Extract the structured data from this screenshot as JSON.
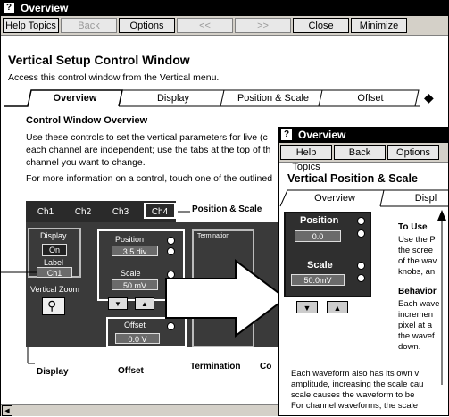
{
  "back_window": {
    "title": "Overview",
    "toolbar": {
      "help_topics": "Help Topics",
      "back": "Back",
      "options": "Options",
      "prev": "<<",
      "next": ">>",
      "close": "Close",
      "minimize": "Minimize"
    },
    "heading": "Vertical Setup Control Window",
    "intro": "Access this control window from the Vertical menu.",
    "tabs": [
      "Overview",
      "Display",
      "Position & Scale",
      "Offset"
    ],
    "section_title": "Control Window Overview",
    "body1": "Use these controls to set the vertical parameters for live (c",
    "body2": "each channel are independent; use the tabs at the top of th",
    "body3": "channel you want to change.",
    "body4": "For more information on a control, touch one of the outlined",
    "channel_tabs": [
      "Ch1",
      "Ch2",
      "Ch3",
      "Ch4"
    ],
    "callouts": {
      "position_scale": "Position & Scale",
      "display": "Display",
      "offset": "Offset",
      "termination": "Termination",
      "coupling": "Co"
    },
    "controls": {
      "display_label": "Display",
      "display_value": "On",
      "label_label": "Label",
      "label_value": "Ch1",
      "vzoom_label": "Vertical Zoom",
      "position_label": "Position",
      "position_value": "3.5 div",
      "scale_label": "Scale",
      "scale_value": "50 mV",
      "offset_label": "Offset",
      "offset_value": "0.0 V",
      "termination_label": "Termination"
    }
  },
  "front_window": {
    "title": "Overview",
    "toolbar": {
      "help_topics": "Help Topics",
      "back": "Back",
      "options": "Options"
    },
    "heading": "Vertical Position & Scale",
    "tabs": [
      "Overview",
      "Displ"
    ],
    "controls": {
      "position_label": "Position",
      "position_value": "0.0",
      "scale_label": "Scale",
      "scale_value": "50.0mV"
    },
    "to_use_title": "To Use",
    "to_use_lines": [
      "Use the P",
      "the scree",
      "of the wav",
      "knobs, an"
    ],
    "behavior_title": "Behavior",
    "behavior_lines": [
      "Each wave",
      "incremen",
      "pixel at a",
      "the wavef",
      "down."
    ],
    "bottom_lines": [
      "Each waveform also has its own v",
      "amplitude, increasing the scale cau",
      "scale causes the waveform to be",
      "For channel waveforms, the scale"
    ]
  }
}
